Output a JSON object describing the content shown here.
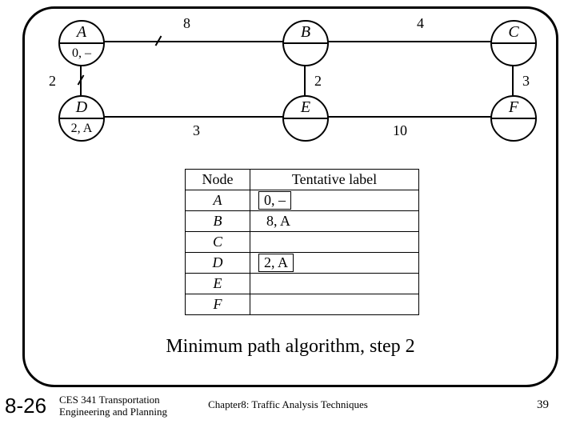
{
  "graph": {
    "nodes": {
      "A": {
        "letter": "A",
        "label": "0, –"
      },
      "B": {
        "letter": "B",
        "label": ""
      },
      "C": {
        "letter": "C",
        "label": ""
      },
      "D": {
        "letter": "D",
        "label": "2, A"
      },
      "E": {
        "letter": "E",
        "label": ""
      },
      "F": {
        "letter": "F",
        "label": ""
      }
    },
    "edges": {
      "AB": {
        "weight": "8",
        "marked": true
      },
      "BC": {
        "weight": "4",
        "marked": false
      },
      "AD": {
        "weight": "2",
        "marked": true
      },
      "BE": {
        "weight": "2",
        "marked": false
      },
      "CF": {
        "weight": "3",
        "marked": false
      },
      "DE": {
        "weight": "3",
        "marked": false
      },
      "EF": {
        "weight": "10",
        "marked": false
      }
    }
  },
  "table": {
    "headers": {
      "node": "Node",
      "label": "Tentative label"
    },
    "rows": [
      {
        "node": "A",
        "label": "0, –",
        "boxed": true
      },
      {
        "node": "B",
        "label": "8, A",
        "boxed": false
      },
      {
        "node": "C",
        "label": "",
        "boxed": false
      },
      {
        "node": "D",
        "label": "2, A",
        "boxed": true
      },
      {
        "node": "E",
        "label": "",
        "boxed": false
      },
      {
        "node": "F",
        "label": "",
        "boxed": false
      }
    ]
  },
  "caption": "Minimum path algorithm, step 2",
  "footer": {
    "figure": "8-26",
    "course_line1": "CES 341 Transportation",
    "course_line2": "Engineering and Planning",
    "chapter": "Chapter8: Traffic Analysis Techniques",
    "page": "39"
  }
}
